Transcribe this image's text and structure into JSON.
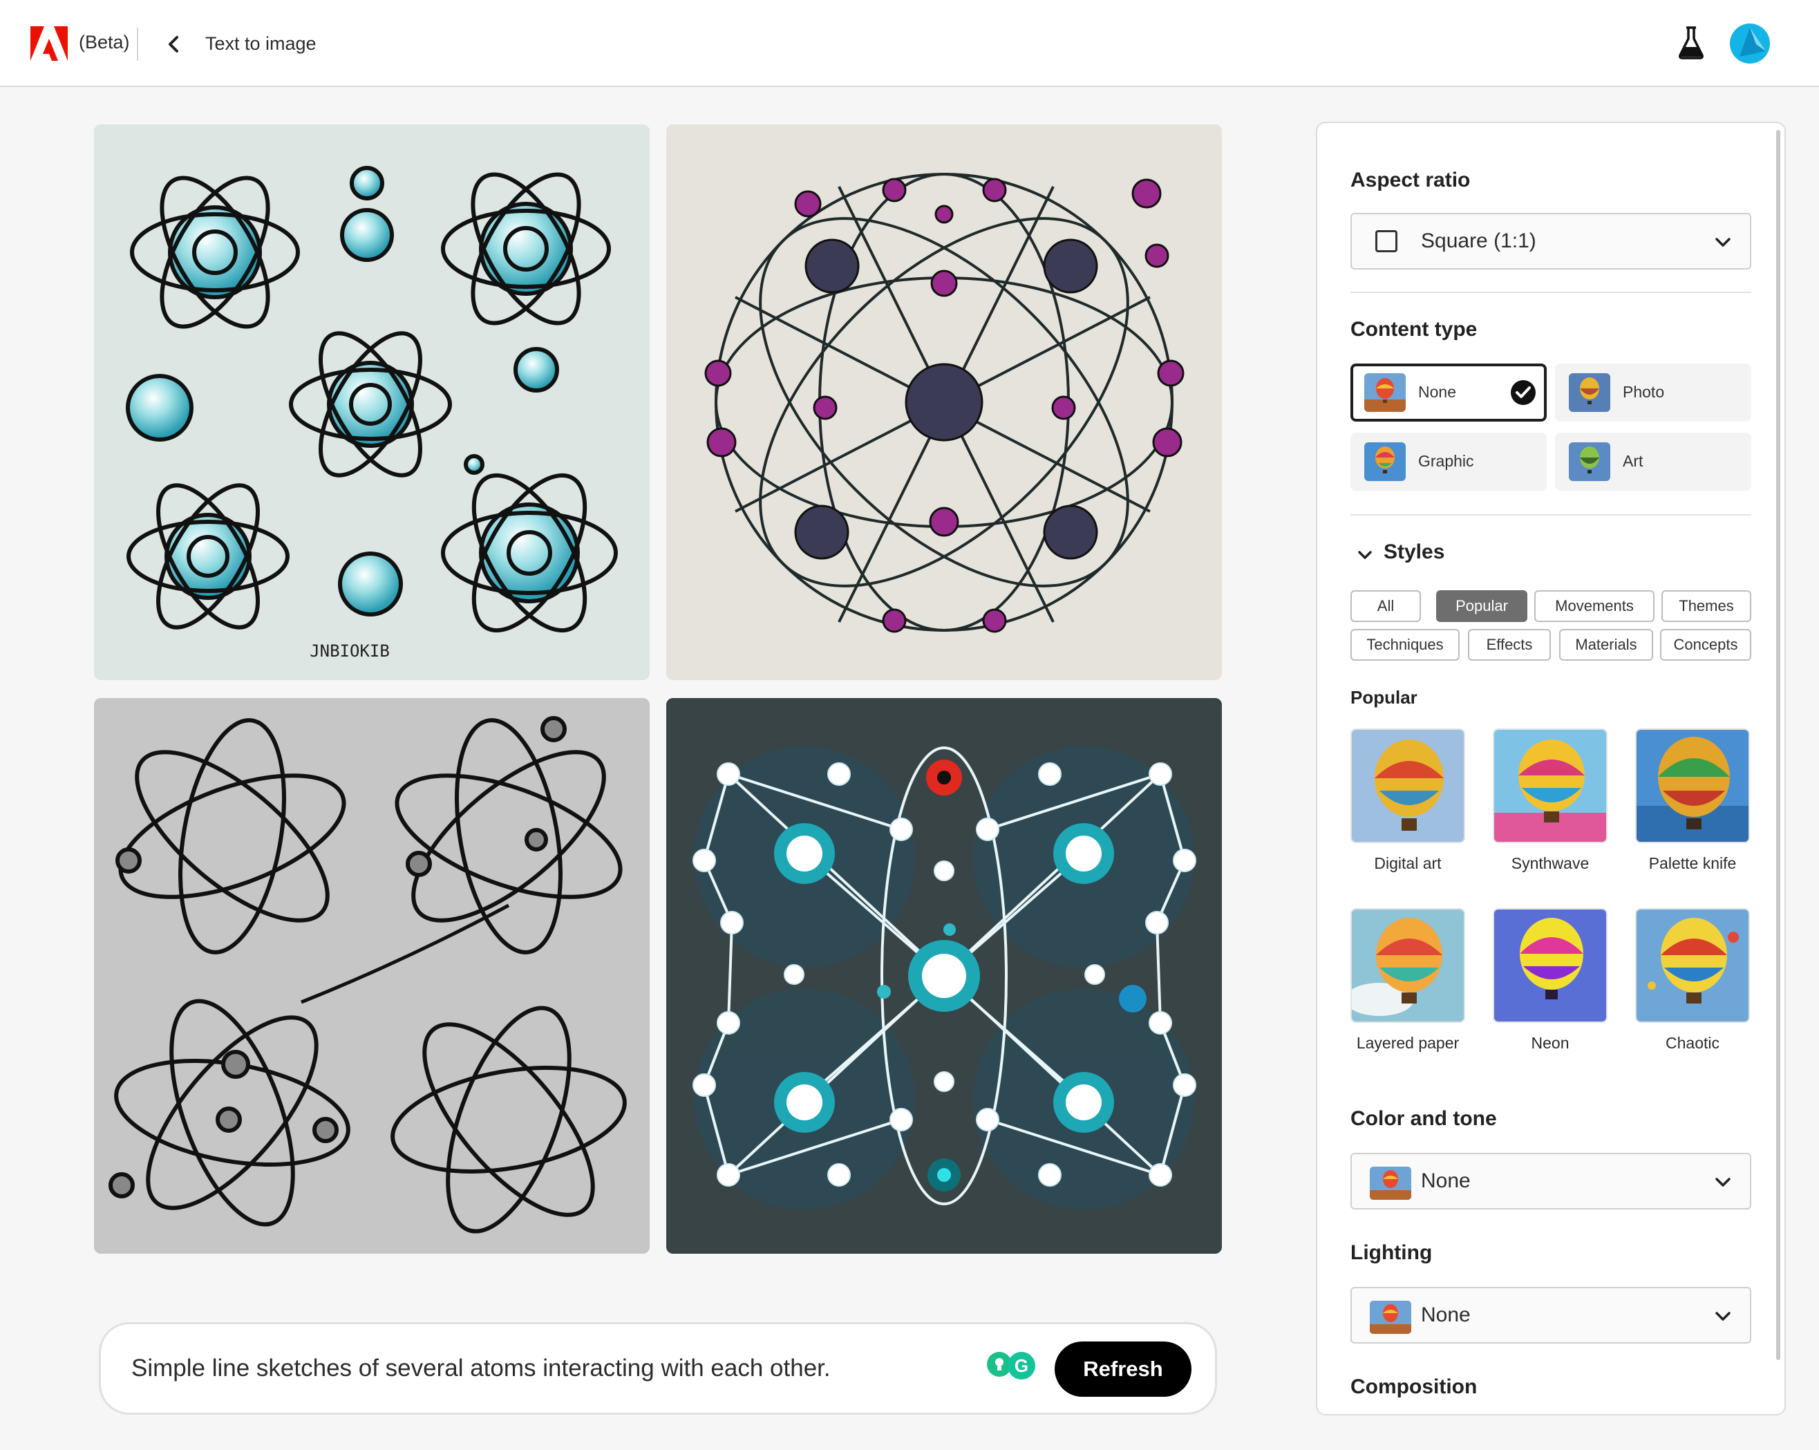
{
  "header": {
    "brand_icon": "adobe-logo",
    "beta_label": "(Beta)",
    "page_title": "Text to image",
    "labs_icon": "flask-icon",
    "avatar_icon": "user-avatar"
  },
  "prompt": {
    "text": "Simple line sketches of several atoms interacting with each other.",
    "refresh_label": "Refresh",
    "grammar_badge": "G"
  },
  "panel": {
    "aspect_ratio": {
      "heading": "Aspect ratio",
      "value": "Square (1:1)"
    },
    "content_type": {
      "heading": "Content type",
      "options": [
        "None",
        "Photo",
        "Graphic",
        "Art"
      ],
      "selected": "None"
    },
    "styles": {
      "heading": "Styles",
      "chips_row1": [
        "All",
        "Popular",
        "Movements",
        "Themes"
      ],
      "chips_row2": [
        "Techniques",
        "Effects",
        "Materials",
        "Concepts"
      ],
      "active_chip": "Popular",
      "section_heading": "Popular",
      "items": [
        "Digital art",
        "Synthwave",
        "Palette knife",
        "Layered paper",
        "Neon",
        "Chaotic"
      ]
    },
    "color_tone": {
      "heading": "Color and tone",
      "value": "None"
    },
    "lighting": {
      "heading": "Lighting",
      "value": "None"
    },
    "composition": {
      "heading": "Composition"
    }
  },
  "images": {
    "tile1_signature": "JNBIOKIB"
  },
  "colors": {
    "adobe_red": "#eb1000",
    "avatar_blue": "#14b4e6",
    "teal": "#4fb8c6",
    "purple": "#9a2b8c"
  }
}
